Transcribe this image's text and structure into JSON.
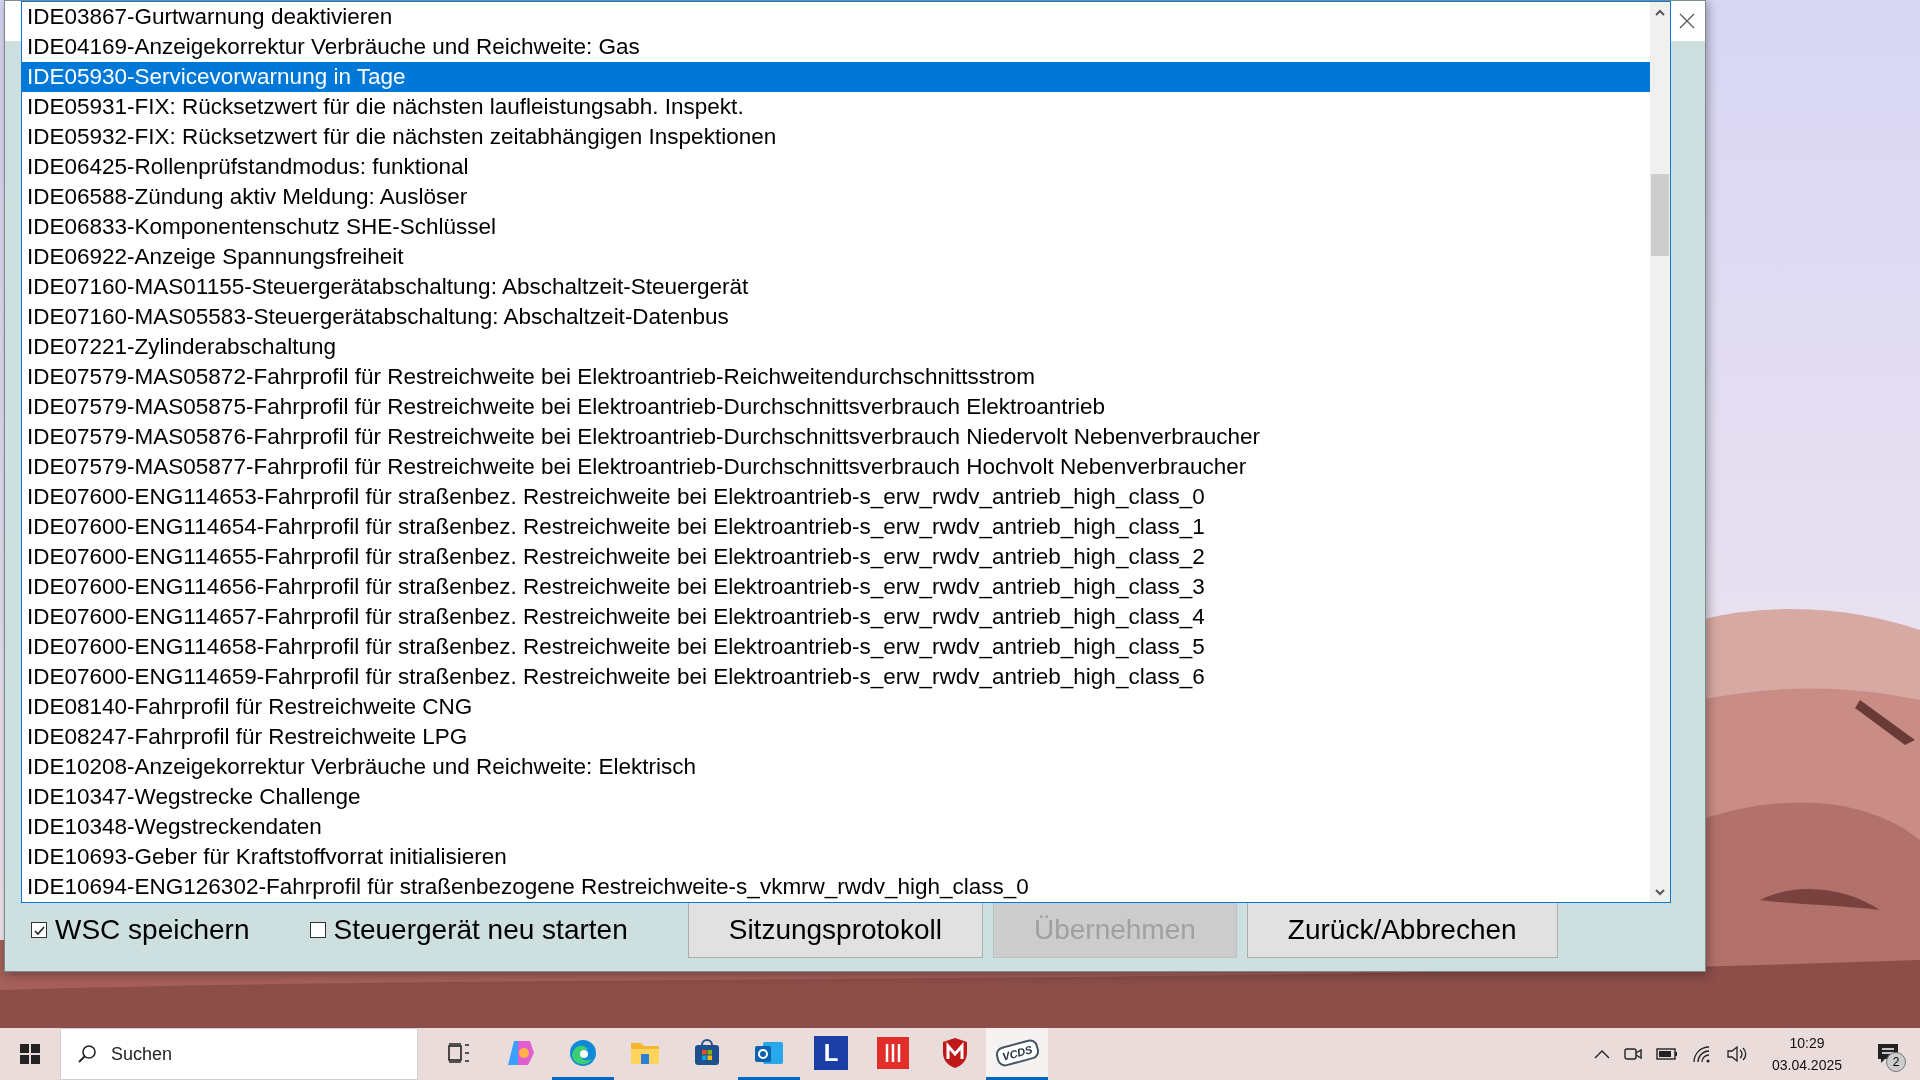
{
  "dialog": {
    "list": {
      "items": [
        {
          "label": "IDE03867-Gurtwarnung deaktivieren",
          "selected": false
        },
        {
          "label": "IDE04169-Anzeigekorrektur Verbräuche und Reichweite: Gas",
          "selected": false
        },
        {
          "label": "IDE05930-Servicevorwarnung in Tage",
          "selected": true
        },
        {
          "label": "IDE05931-FIX: Rücksetzwert für die nächsten laufleistungsabh. Inspekt.",
          "selected": false
        },
        {
          "label": "IDE05932-FIX: Rücksetzwert für die nächsten zeitabhängigen Inspektionen",
          "selected": false
        },
        {
          "label": "IDE06425-Rollenprüfstandmodus: funktional",
          "selected": false
        },
        {
          "label": "IDE06588-Zündung aktiv Meldung: Auslöser",
          "selected": false
        },
        {
          "label": "IDE06833-Komponentenschutz SHE-Schlüssel",
          "selected": false
        },
        {
          "label": "IDE06922-Anzeige Spannungsfreiheit",
          "selected": false
        },
        {
          "label": "IDE07160-MAS01155-Steuergerätabschaltung: Abschaltzeit-Steuergerät",
          "selected": false
        },
        {
          "label": "IDE07160-MAS05583-Steuergerätabschaltung: Abschaltzeit-Datenbus",
          "selected": false
        },
        {
          "label": "IDE07221-Zylinderabschaltung",
          "selected": false
        },
        {
          "label": "IDE07579-MAS05872-Fahrprofil für Restreichweite bei Elektroantrieb-Reichweitendurchschnittsstrom",
          "selected": false
        },
        {
          "label": "IDE07579-MAS05875-Fahrprofil für Restreichweite bei Elektroantrieb-Durchschnittsverbrauch Elektroantrieb",
          "selected": false
        },
        {
          "label": "IDE07579-MAS05876-Fahrprofil für Restreichweite bei Elektroantrieb-Durchschnittsverbrauch Niedervolt Nebenverbraucher",
          "selected": false
        },
        {
          "label": "IDE07579-MAS05877-Fahrprofil für Restreichweite bei Elektroantrieb-Durchschnittsverbrauch Hochvolt Nebenverbraucher",
          "selected": false
        },
        {
          "label": "IDE07600-ENG114653-Fahrprofil für straßenbez. Restreichweite bei Elektroantrieb-s_erw_rwdv_antrieb_high_class_0",
          "selected": false
        },
        {
          "label": "IDE07600-ENG114654-Fahrprofil für straßenbez. Restreichweite bei Elektroantrieb-s_erw_rwdv_antrieb_high_class_1",
          "selected": false
        },
        {
          "label": "IDE07600-ENG114655-Fahrprofil für straßenbez. Restreichweite bei Elektroantrieb-s_erw_rwdv_antrieb_high_class_2",
          "selected": false
        },
        {
          "label": "IDE07600-ENG114656-Fahrprofil für straßenbez. Restreichweite bei Elektroantrieb-s_erw_rwdv_antrieb_high_class_3",
          "selected": false
        },
        {
          "label": "IDE07600-ENG114657-Fahrprofil für straßenbez. Restreichweite bei Elektroantrieb-s_erw_rwdv_antrieb_high_class_4",
          "selected": false
        },
        {
          "label": "IDE07600-ENG114658-Fahrprofil für straßenbez. Restreichweite bei Elektroantrieb-s_erw_rwdv_antrieb_high_class_5",
          "selected": false
        },
        {
          "label": "IDE07600-ENG114659-Fahrprofil für straßenbez. Restreichweite bei Elektroantrieb-s_erw_rwdv_antrieb_high_class_6",
          "selected": false
        },
        {
          "label": "IDE08140-Fahrprofil für Restreichweite CNG",
          "selected": false
        },
        {
          "label": "IDE08247-Fahrprofil für Restreichweite LPG",
          "selected": false
        },
        {
          "label": "IDE10208-Anzeigekorrektur Verbräuche und Reichweite: Elektrisch",
          "selected": false
        },
        {
          "label": "IDE10347-Wegstrecke Challenge",
          "selected": false
        },
        {
          "label": "IDE10348-Wegstreckendaten",
          "selected": false
        },
        {
          "label": "IDE10693-Geber für Kraftstoffvorrat initialisieren",
          "selected": false
        },
        {
          "label": "IDE10694-ENG126302-Fahrprofil für straßenbezogene Restreichweite-s_vkmrw_rwdv_high_class_0",
          "selected": false
        }
      ]
    },
    "options": [
      {
        "label": "WSC speichern",
        "checked": true
      },
      {
        "label": "Steuergerät neu starten",
        "checked": false
      }
    ],
    "buttons": [
      {
        "label": "Sitzungsprotokoll",
        "disabled": false
      },
      {
        "label": "Übernehmen",
        "disabled": true
      },
      {
        "label": "Zurück/Abbrechen",
        "disabled": false
      }
    ]
  },
  "taskbar": {
    "search": {
      "placeholder": "Suchen"
    },
    "apps": [
      {
        "kind": "taskview",
        "running": false,
        "selected": false
      },
      {
        "kind": "copilot",
        "running": false,
        "selected": false
      },
      {
        "kind": "edge",
        "running": true,
        "selected": false
      },
      {
        "kind": "explorer",
        "running": false,
        "selected": false
      },
      {
        "kind": "store",
        "running": false,
        "selected": false
      },
      {
        "kind": "outlook",
        "running": true,
        "selected": false
      },
      {
        "kind": "letter",
        "text": "L",
        "running": false,
        "selected": false
      },
      {
        "kind": "mixer",
        "running": false,
        "selected": false
      },
      {
        "kind": "shield",
        "running": false,
        "selected": false
      },
      {
        "kind": "vcds",
        "text": "VCDS",
        "running": true,
        "selected": true
      }
    ],
    "time": "10:29",
    "date": "03.04.2025",
    "notifications": "2"
  }
}
